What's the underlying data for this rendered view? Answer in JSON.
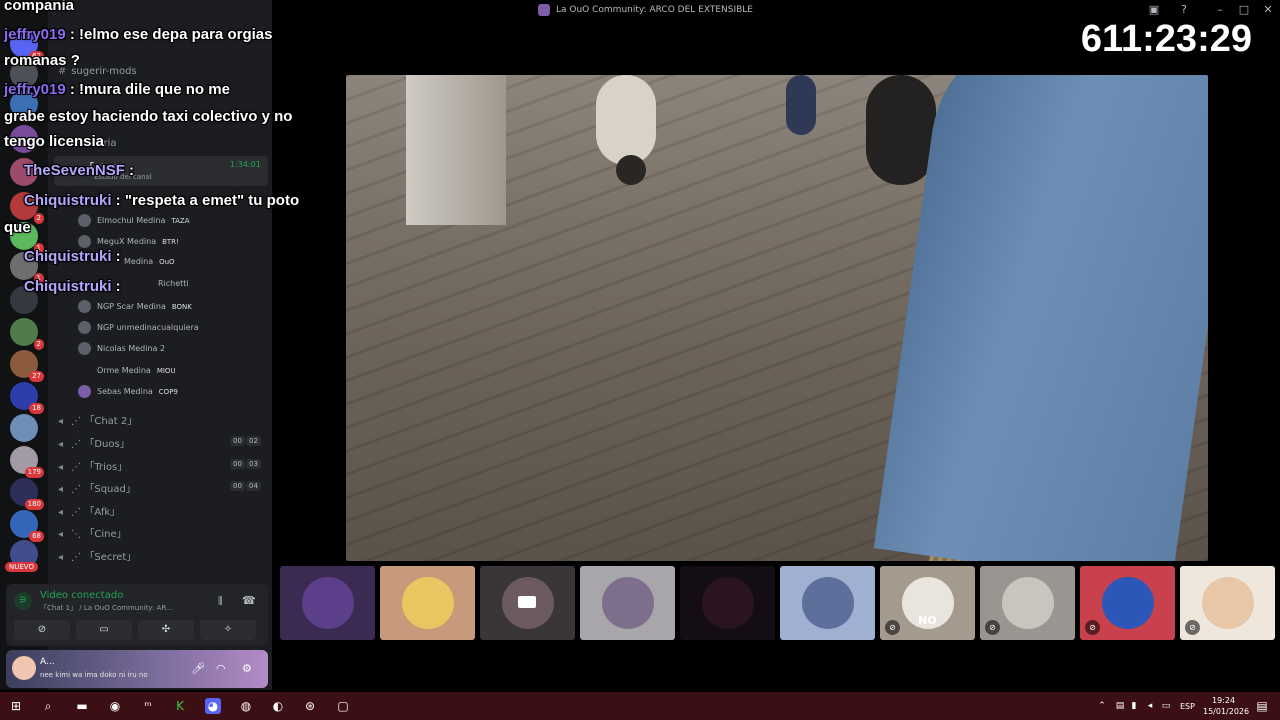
{
  "window": {
    "title": "La OuO Community: ARCO DEL EXTENSIBLE"
  },
  "timer": "611:23:29",
  "chat_overlay": [
    {
      "text": "compania"
    },
    {
      "user": "jeffry019",
      "text": " : !elmo ese depa para orgias"
    },
    {
      "text": "romanas ?"
    },
    {
      "user": "jeffry019",
      "text": " : !mura    dile que no me"
    },
    {
      "text": "grabe estoy haciendo taxi colectivo y no"
    },
    {
      "text": "tengo licensia"
    },
    {
      "user": "TheSevenNSF",
      "text": " :"
    },
    {
      "user": "Chiquistruki",
      "text": " : \"respeta a emet\" tu poto"
    },
    {
      "text": "que"
    },
    {
      "user": "Chiquistruki",
      "text": " :"
    },
    {
      "user": "Chiquistruki",
      "text": " :"
    }
  ],
  "sidebar": {
    "channels_top": [
      {
        "label": "sugerir-mods"
      },
      {
        "label": "Auditoria"
      }
    ],
    "active_channel": {
      "label": "「Chat」",
      "time": "1:34:01",
      "status": "Estado del canal"
    },
    "members": [
      {
        "name": "Elmochul Medina",
        "tag": "TAZA"
      },
      {
        "name": "MeguX Medina",
        "tag": "BTR!"
      },
      {
        "name": "Medina",
        "tag": "OuO"
      },
      {
        "name": "Richetti",
        "tag": ""
      },
      {
        "name": "NGP Scar Medina",
        "tag": "BONK"
      },
      {
        "name": "NGP unmedinacualquiera",
        "tag": ""
      },
      {
        "name": "Nicolas Medina 2",
        "tag": ""
      },
      {
        "name": "Orme Medina",
        "tag": "MIOU"
      },
      {
        "name": "Sebas Medina",
        "tag": "COP9"
      }
    ],
    "voice_channels": [
      {
        "label": "「Chat 2」",
        "count_a": "",
        "count_b": ""
      },
      {
        "label": "「Duos」",
        "count_a": "00",
        "count_b": "02"
      },
      {
        "label": "「Trios」",
        "count_a": "00",
        "count_b": "03"
      },
      {
        "label": "「Squad」",
        "count_a": "00",
        "count_b": "04"
      },
      {
        "label": "「Afk」",
        "count_a": "",
        "count_b": ""
      },
      {
        "label": "「Cine」",
        "count_a": "",
        "count_b": ""
      },
      {
        "label": "「Secret」",
        "count_a": "",
        "count_b": ""
      }
    ],
    "new_badge": "NUEVO",
    "server_badges": [
      "62",
      "2",
      "1",
      "1",
      "2",
      "27",
      "18",
      "179",
      "180",
      "68"
    ]
  },
  "voice_status": {
    "title": "Video conectado",
    "subtitle": "「Chat 1」 / La OuO Community: AR..."
  },
  "user": {
    "name": "A...",
    "status": "nee kimi wa ima doko ni iru no"
  },
  "tiles": [
    {
      "color": "#3b2a52",
      "avatar": "#5b3f8a",
      "mute": false,
      "text": ""
    },
    {
      "color": "#c79a7b",
      "avatar": "#e8c660",
      "mute": false,
      "text": ""
    },
    {
      "color": "#3a3538",
      "avatar": "#6b5a5e",
      "mute": false,
      "text": ""
    },
    {
      "color": "#a8a6aa",
      "avatar": "#7d6f8c",
      "mute": false,
      "text": ""
    },
    {
      "color": "#140d14",
      "avatar": "#2a1422",
      "mute": false,
      "text": ""
    },
    {
      "color": "#9fb0d3",
      "avatar": "#5e6f9c",
      "mute": false,
      "text": ""
    },
    {
      "color": "#a59a8e",
      "avatar": "#e9e4dd",
      "mute": true,
      "text": "NO"
    },
    {
      "color": "#9a9590",
      "avatar": "#c9c4bc",
      "mute": true,
      "text": ""
    },
    {
      "color": "#c8414d",
      "avatar": "#2c57b8",
      "mute": true,
      "text": ""
    },
    {
      "color": "#efe7dc",
      "avatar": "#e7c7a8",
      "mute": true,
      "text": ""
    }
  ],
  "taskbar": {
    "language": "ESP",
    "time": "19:24",
    "date": "15/01/2026"
  }
}
